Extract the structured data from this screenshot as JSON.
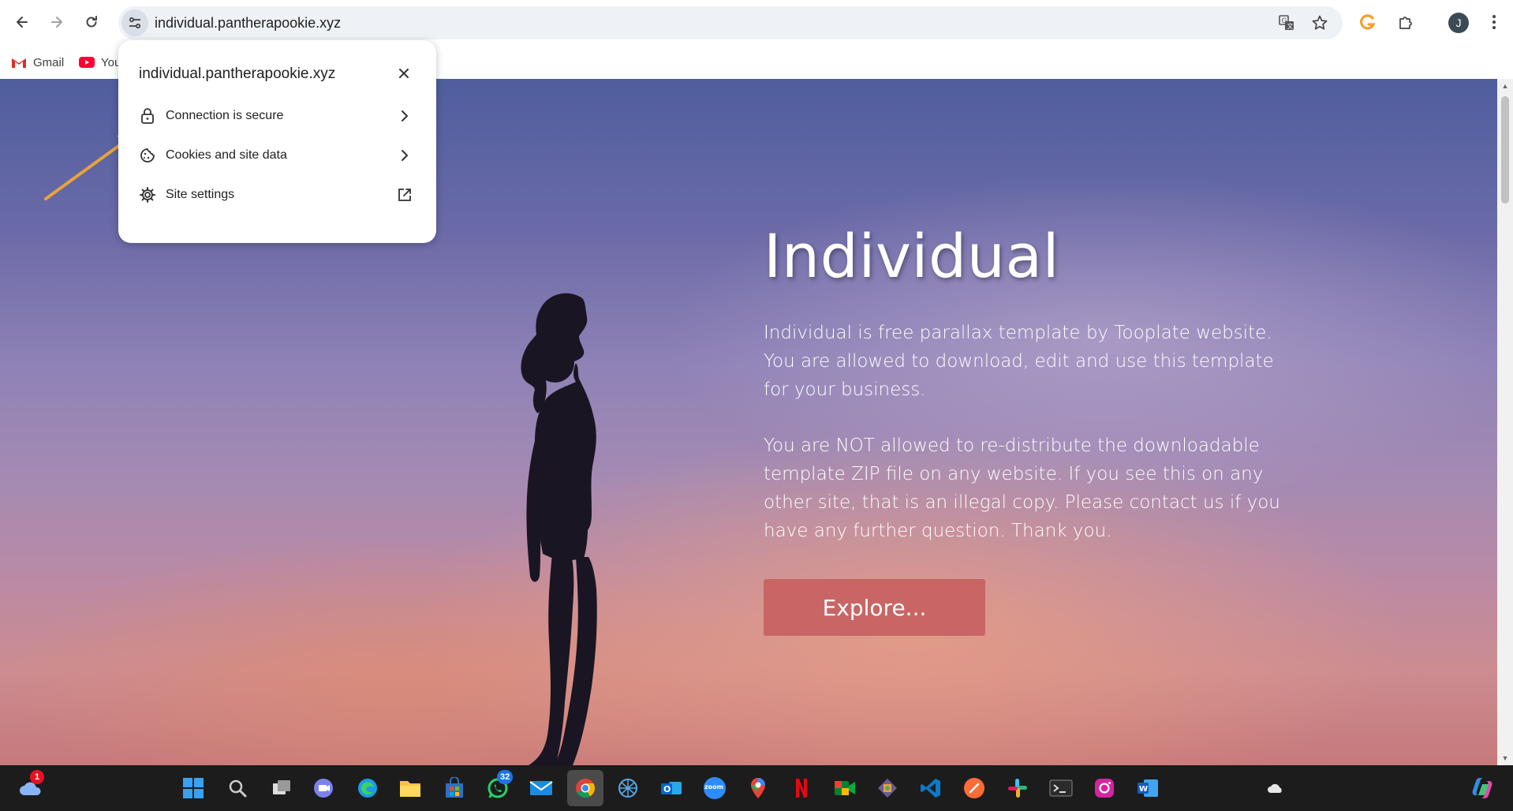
{
  "browser": {
    "url": "individual.pantherapookie.xyz",
    "avatar_letter": "J",
    "icons": {
      "back": "arrow-left-icon",
      "forward": "arrow-right-icon",
      "reload": "reload-icon",
      "site_info": "tune-icon",
      "translate": "translate-icon",
      "bookmark": "star-icon",
      "extension_g": "grammarly-icon",
      "extensions": "puzzle-icon",
      "menu": "kebab-menu-icon"
    }
  },
  "bookmarks": [
    {
      "label": "Gmail",
      "icon": "gmail-icon"
    },
    {
      "label": "You",
      "icon": "youtube-icon"
    }
  ],
  "site_info_popup": {
    "title": "individual.pantherapookie.xyz",
    "rows": [
      {
        "label": "Connection is secure",
        "icon": "lock-icon",
        "trailing": "chevron-right-icon"
      },
      {
        "label": "Cookies and site data",
        "icon": "cookie-icon",
        "trailing": "chevron-right-icon"
      },
      {
        "label": "Site settings",
        "icon": "gear-icon",
        "trailing": "open-external-icon"
      }
    ]
  },
  "hero": {
    "title": "Individual",
    "paragraph1": "Individual is free parallax template by Tooplate website. You are allowed to download, edit and use this template for your business.",
    "paragraph2": "You are NOT allowed to re-distribute the downloadable template ZIP file on any website. If you see this on any other site, that is an illegal copy. Please contact us if you have any further question. Thank you.",
    "button": "Explore..."
  },
  "taskbar": {
    "weather_badge": "1",
    "whatsapp_badge": "32",
    "zoom_label": "zoom",
    "apps": [
      "weather-icon",
      "windows-start-icon",
      "search-icon",
      "task-view-icon",
      "teams-icon",
      "edge-icon",
      "file-explorer-icon",
      "store-icon",
      "whatsapp-icon",
      "mail-icon",
      "chrome-icon",
      "network-icon",
      "outlook-icon",
      "zoom-icon",
      "maps-icon",
      "netflix-icon",
      "meet-icon",
      "git-icon",
      "vscode-icon",
      "postman-icon",
      "slack-icon",
      "terminal-icon",
      "instagram-icon",
      "word-icon",
      "onedrive-icon",
      "copilot-icon"
    ]
  },
  "colors": {
    "accent_button": "#c96565",
    "annotation_arrow": "#e8a33a"
  }
}
